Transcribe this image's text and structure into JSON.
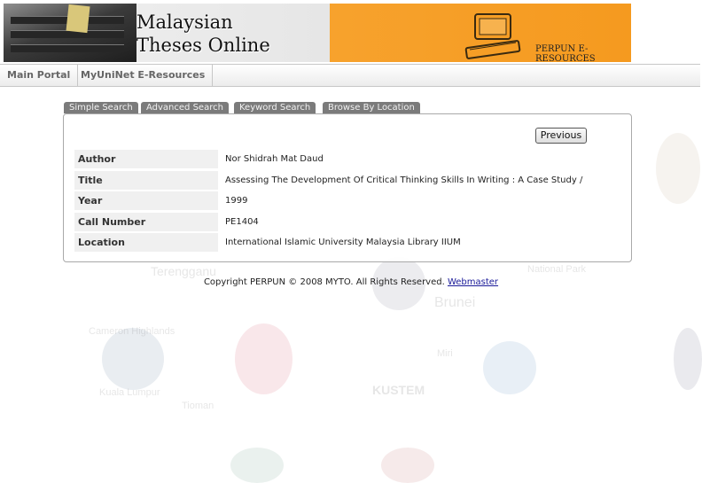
{
  "banner": {
    "title_line1": "Malaysian",
    "title_line2": "Theses Online",
    "brand": "PERPUN E-RESOURCES"
  },
  "nav": {
    "items": [
      "Main Portal",
      "MyUniNet E-Resources"
    ]
  },
  "tabs": [
    "Simple Search",
    "Advanced Search",
    "Keyword Search",
    "Browse By Location"
  ],
  "record": {
    "previous_label": "Previous",
    "fields": [
      {
        "label": "Author",
        "value": "Nor Shidrah Mat Daud"
      },
      {
        "label": "Title",
        "value": "Assessing The Development Of Critical Thinking Skills In Writing : A Case Study /"
      },
      {
        "label": "Year",
        "value": "1999"
      },
      {
        "label": "Call Number",
        "value": "PE1404"
      },
      {
        "label": "Location",
        "value": "International Islamic University Malaysia Library IIUM"
      }
    ]
  },
  "footer": {
    "copyright": "Copyright PERPUN © 2008 MYTO. All Rights Reserved.",
    "webmaster": "Webmaster"
  },
  "background_words": [
    "Terengganu",
    "Brunei",
    "Tioman",
    "KUSTEM",
    "Cameron Highlands",
    "National Park",
    "Kuala Lumpur",
    "Miri"
  ],
  "colors": {
    "banner_orange": "#f59a1f",
    "tab_grey": "#7b7b7b",
    "link_blue": "#1a1a99"
  }
}
